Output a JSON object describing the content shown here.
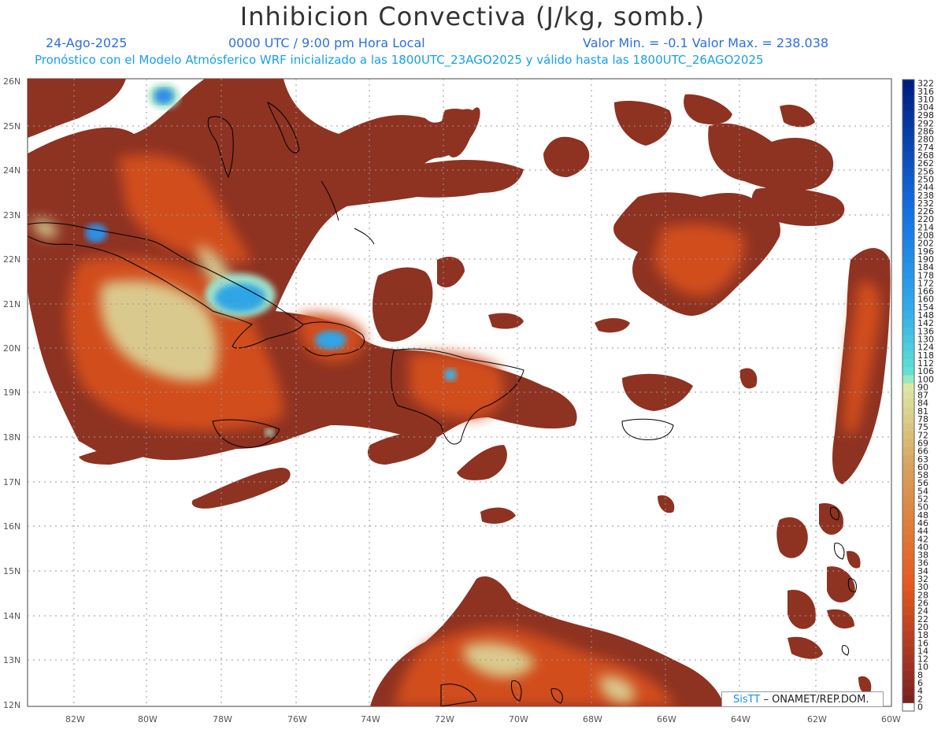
{
  "header": {
    "title": "Inhibicion Convectiva (J/kg, somb.)",
    "date": "24-Ago-2025",
    "time": "0000 UTC / 9:00 pm Hora Local",
    "minmax": "Valor Min. = -0.1  Valor Max. = 238.038",
    "model_line": "Pronóstico con el Modelo Atmósferico WRF inicializado a las 1800UTC_23AGO2025 y válido hasta las  1800UTC_26AGO2025"
  },
  "axes": {
    "lat_labels": [
      "26N",
      "25N",
      "24N",
      "23N",
      "22N",
      "21N",
      "20N",
      "19N",
      "18N",
      "17N",
      "16N",
      "15N",
      "14N",
      "13N",
      "12N"
    ],
    "lon_labels": [
      "82W",
      "80W",
      "78W",
      "76W",
      "74W",
      "72W",
      "70W",
      "68W",
      "66W",
      "64W",
      "62W",
      "60W"
    ]
  },
  "colorbar": {
    "labels": [
      "322",
      "316",
      "310",
      "304",
      "298",
      "292",
      "286",
      "280",
      "274",
      "268",
      "262",
      "256",
      "250",
      "244",
      "238",
      "232",
      "226",
      "220",
      "214",
      "208",
      "202",
      "196",
      "190",
      "184",
      "178",
      "172",
      "166",
      "160",
      "154",
      "148",
      "142",
      "136",
      "130",
      "124",
      "118",
      "112",
      "106",
      "100",
      "90",
      "87",
      "84",
      "81",
      "78",
      "75",
      "72",
      "69",
      "66",
      "63",
      "60",
      "58",
      "56",
      "54",
      "52",
      "50",
      "48",
      "46",
      "44",
      "42",
      "40",
      "38",
      "36",
      "34",
      "32",
      "30",
      "28",
      "26",
      "24",
      "22",
      "20",
      "18",
      "16",
      "14",
      "12",
      "10",
      "8",
      "6",
      "4",
      "2",
      "0"
    ]
  },
  "credit": {
    "logo": "SisTT",
    "text": "– ONAMET/REP.DOM."
  },
  "colors": {
    "low": "#8b2f21",
    "mid": "#d8501e",
    "high_warm": "#d9d99a",
    "cool": "#2fa6e6",
    "title": "#333333",
    "header_blue": "#2e6fe0",
    "subheader_blue": "#16a0e8"
  }
}
